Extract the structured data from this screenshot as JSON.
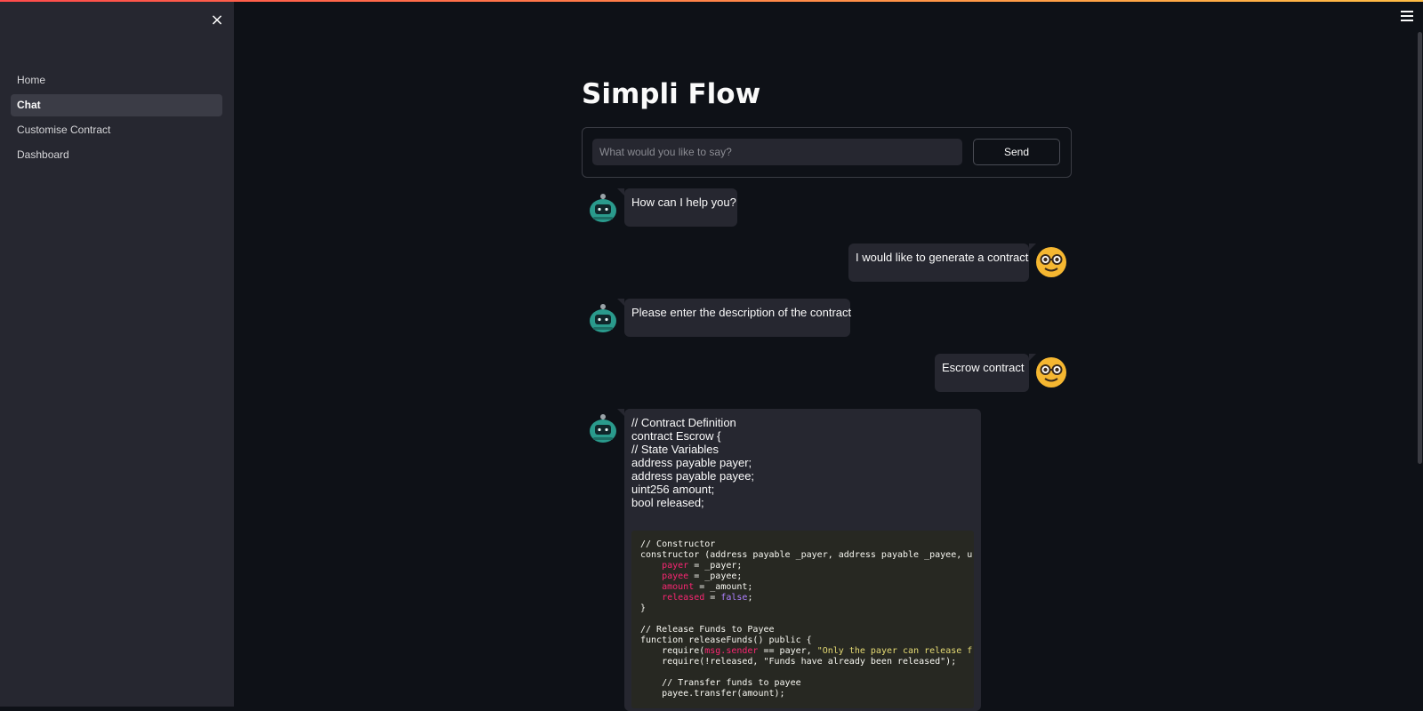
{
  "sidebar": {
    "close_label": "×",
    "items": [
      {
        "label": "Home"
      },
      {
        "label": "Chat",
        "active": true
      },
      {
        "label": "Customise Contract"
      },
      {
        "label": "Dashboard"
      }
    ]
  },
  "main": {
    "title": "Simpli Flow",
    "input_placeholder": "What would you like to say?",
    "input_value": "",
    "send_label": "Send"
  },
  "messages": [
    {
      "role": "assistant",
      "text": "How can I help you?"
    },
    {
      "role": "user",
      "text": "I would like to generate a contract"
    },
    {
      "role": "assistant",
      "text": "Please enter the description of the contract"
    },
    {
      "role": "user",
      "text": "Escrow contract"
    },
    {
      "role": "assistant",
      "lines": [
        "// Contract Definition",
        "contract Escrow {",
        "// State Variables",
        "address payable payer;",
        "address payable payee;",
        "uint256 amount;",
        "bool released;"
      ]
    }
  ],
  "code": {
    "comment_constructor": "// Constructor",
    "constructor_sig": "constructor (address payable _payer, address payable _payee, u",
    "assign_payer_lhs": "payer",
    "assign_payer_rhs": " = _payer;",
    "assign_payee_lhs": "payee",
    "assign_payee_rhs": " = _payee;",
    "assign_amount_lhs": "amount",
    "assign_amount_rhs": " = _amount;",
    "assign_released_lhs": "released",
    "assign_released_mid": " = ",
    "assign_released_val": "false",
    "assign_released_end": ";",
    "close_brace": "}",
    "comment_release": "// Release Funds to Payee",
    "function_sig": "function releaseFunds() public {",
    "require1_pre": "    require(",
    "require1_kw": "msg.sender",
    "require1_mid": " == payer, ",
    "require1_str": "\"Only the payer can release f",
    "require2": "    require(!released, \"Funds have already been released\");",
    "comment_transfer": "    // Transfer funds to payee",
    "transfer": "    payee.transfer(amount);"
  },
  "icons": {
    "bot_avatar": "robot-icon",
    "user_avatar": "nerd-face-icon",
    "menu": "hamburger-menu-icon",
    "close": "close-icon"
  },
  "colors": {
    "background": "#0e1117",
    "sidebar": "#262730",
    "bubble": "#262730",
    "code_bg": "#272822",
    "accent_red": "#ff4b4b",
    "user_avatar": "#f5b731",
    "bot_avatar": "#2a9a8c"
  }
}
